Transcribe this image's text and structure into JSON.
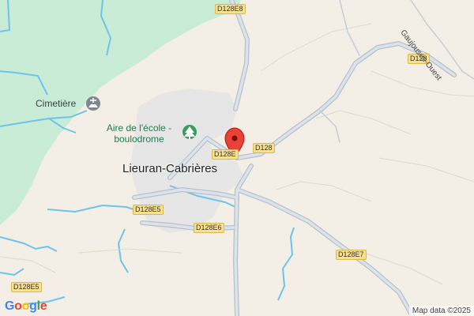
{
  "map": {
    "town": "Lieuran-Cabrières",
    "poi_park": {
      "line1": "Aire de l'école -",
      "line2": "boulodrome"
    },
    "poi_cemetery": "Cimetière",
    "street": "Gaujouses-Ouest",
    "roads": {
      "d128e8": "D128E8",
      "d128_top": "D128",
      "d128_mid": "D128",
      "d128e_marker": "D128E",
      "d128e5_a": "D128E5",
      "d128e6": "D128E6",
      "d128e7": "D128E7",
      "d128e5_b": "D128E5"
    },
    "colors": {
      "land": "#f3efe6",
      "forest": "#c9ecd6",
      "built": "#e8e8e8",
      "road": "#c4cbd6",
      "water": "#6fc3eb",
      "marker": "#ea4335"
    }
  },
  "footer": {
    "logo_letters": [
      {
        "ch": "G",
        "color": "#4285f4"
      },
      {
        "ch": "o",
        "color": "#ea4335"
      },
      {
        "ch": "o",
        "color": "#fbbc05"
      },
      {
        "ch": "g",
        "color": "#4285f4"
      },
      {
        "ch": "l",
        "color": "#34a853"
      },
      {
        "ch": "e",
        "color": "#ea4335"
      }
    ],
    "attribution": "Map data ©2025"
  }
}
